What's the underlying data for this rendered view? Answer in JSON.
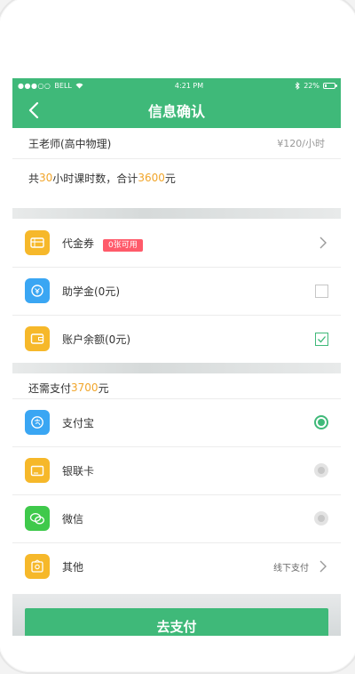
{
  "status_bar": {
    "carrier": "BELL",
    "time": "4:21 PM",
    "battery": "22%",
    "battery_level": 0.22
  },
  "nav": {
    "title": "信息确认"
  },
  "teacher": {
    "name": "王老师(高中物理)",
    "price": "¥120/小时"
  },
  "summary": {
    "prefix": "共",
    "hours": "30",
    "mid": "小时课时数，合计",
    "total": "3600",
    "suffix": "元"
  },
  "discounts": [
    {
      "label": "代金券",
      "badge": "0张可用",
      "control": "chevron",
      "icon": "voucher-icon",
      "color": "#f6b82a"
    },
    {
      "label": "助学金(0元)",
      "control": "checkbox",
      "checked": false,
      "icon": "scholarship-icon",
      "color": "#3aa6f3"
    },
    {
      "label": "账户余额(0元)",
      "control": "checkbox",
      "checked": true,
      "icon": "wallet-icon",
      "color": "#f6b82a"
    }
  ],
  "remaining": {
    "prefix": "还需支付",
    "amount": "3700",
    "suffix": "元"
  },
  "payments": [
    {
      "label": "支付宝",
      "selected": true,
      "icon": "alipay-icon",
      "color": "#3aa6f3"
    },
    {
      "label": "银联卡",
      "selected": false,
      "icon": "bank-card-icon",
      "color": "#f6b82a"
    },
    {
      "label": "微信",
      "selected": false,
      "icon": "wechat-icon",
      "color": "#3fc94b"
    },
    {
      "label": "其他",
      "selected": false,
      "icon": "other-pay-icon",
      "color": "#f6b82a",
      "note": "线下支付"
    }
  ],
  "pay_button": {
    "label": "去支付"
  },
  "colors": {
    "brand": "#3fb979",
    "highlight": "#f1a52a",
    "badge": "#ff5a6a"
  }
}
